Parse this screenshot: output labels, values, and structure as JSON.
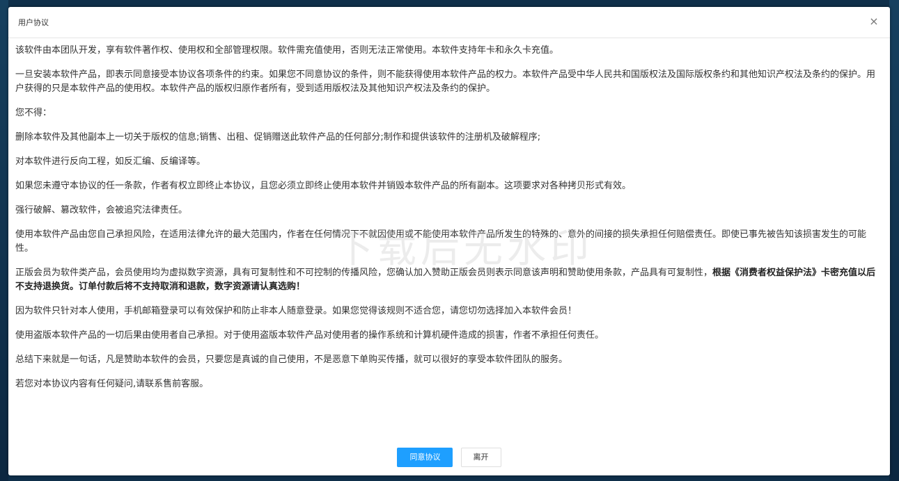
{
  "dialog": {
    "title": "用户协议",
    "close_glyph": "×",
    "paragraphs": [
      "该软件由本团队开发，享有软件著作权、使用权和全部管理权限。软件需充值使用，否则无法正常使用。本软件支持年卡和永久卡充值。",
      "一旦安装本软件产品，即表示同意接受本协议各项条件的约束。如果您不同意协议的条件，则不能获得使用本软件产品的权力。本软件产品受中华人民共和国版权法及国际版权条约和其他知识产权法及条约的保护。用户获得的只是本软件产品的使用权。本软件产品的版权归原作者所有，受到适用版权法及其他知识产权法及条约的保护。",
      "您不得：",
      "删除本软件及其他副本上一切关于版权的信息;销售、出租、促销赠送此软件产品的任何部分;制作和提供该软件的注册机及破解程序;",
      "对本软件进行反向工程，如反汇编、反编译等。",
      "如果您未遵守本协议的任一条款，作者有权立即终止本协议，且您必须立即终止使用本软件并销毁本软件产品的所有副本。这项要求对各种拷贝形式有效。",
      "强行破解、篡改软件，会被追究法律责任。",
      "使用本软件产品由您自己承担风险，在适用法律允许的最大范围内，作者在任何情况下不就因使用或不能使用本软件产品所发生的特殊的、意外的间接的损失承担任何赔偿责任。即使已事先被告知该损害发生的可能性。",
      "因为软件只针对本人使用，手机邮箱登录可以有效保护和防止非本人随意登录。如果您觉得该规则不适合您，请您切勿选择加入本软件会员！",
      "使用盗版本软件产品的一切后果由使用者自己承担。对于使用盗版本软件产品对使用者的操作系统和计算机硬件造成的损害，作者不承担任何责任。",
      "总结下来就是一句话，凡是赞助本软件的会员，只要您是真诚的自己使用，不是恶意下单购买传播，就可以很好的享受本软件团队的服务。",
      "若您对本协议内容有任何疑问,请联系售前客服。"
    ],
    "membership_paragraph": {
      "normal": "正版会员为软件类产品，会员使用均为虚拟数字资源，具有可复制性和不可控制的传播风险，您确认加入赞助正版会员则表示同意该声明和赞助使用条款，产品具有可复制性，",
      "bold": "根据《消费者权益保护法》卡密充值以后不支持退换货。订单付款后将不支持取消和退款，数字资源请认真选购！"
    },
    "agree_button": "同意协议",
    "leave_button": "离开"
  },
  "watermark": "下载后无水印",
  "colors": {
    "primary_button": "#1e9fff",
    "backdrop": "#0f2f4a"
  }
}
